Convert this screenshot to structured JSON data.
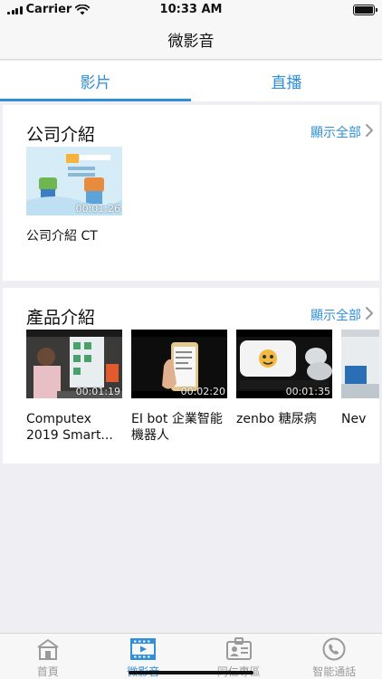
{
  "status_bar": {
    "carrier": "Carrier",
    "time": "10:33 AM",
    "icons": [
      "signal-icon",
      "wifi-icon",
      "battery-icon"
    ]
  },
  "nav": {
    "title": "微影音"
  },
  "tabs": [
    {
      "label": "影片",
      "active": true
    },
    {
      "label": "直播",
      "active": false
    }
  ],
  "sections": [
    {
      "title": "公司介紹",
      "show_all": "顯示全部",
      "videos": [
        {
          "title": "公司介紹 CT",
          "duration": "00:01:26",
          "thumb_icon": "company-intro-thumbnail"
        }
      ]
    },
    {
      "title": "產品介紹",
      "show_all": "顯示全部",
      "videos": [
        {
          "title": "Computex 2019 Smart...",
          "duration": "00:01:19",
          "thumb_icon": "computex-thumbnail"
        },
        {
          "title": "EI bot 企業智能機器人",
          "duration": "00:02:20",
          "thumb_icon": "ei-bot-thumbnail"
        },
        {
          "title": "zenbo 糖尿病",
          "duration": "00:01:35",
          "thumb_icon": "zenbo-thumbnail"
        },
        {
          "title": "Nev",
          "duration": "",
          "thumb_icon": "partial-thumbnail"
        }
      ]
    }
  ],
  "tab_bar": [
    {
      "label": "首頁",
      "icon": "home-icon",
      "active": false
    },
    {
      "label": "微影音",
      "icon": "film-icon",
      "active": true
    },
    {
      "label": "同仁專區",
      "icon": "id-card-icon",
      "active": false
    },
    {
      "label": "智能通話",
      "icon": "phone-icon",
      "active": false
    }
  ],
  "colors": {
    "accent": "#2f8fd8",
    "inactive": "#9a9a9a",
    "background": "#eeeef3"
  }
}
